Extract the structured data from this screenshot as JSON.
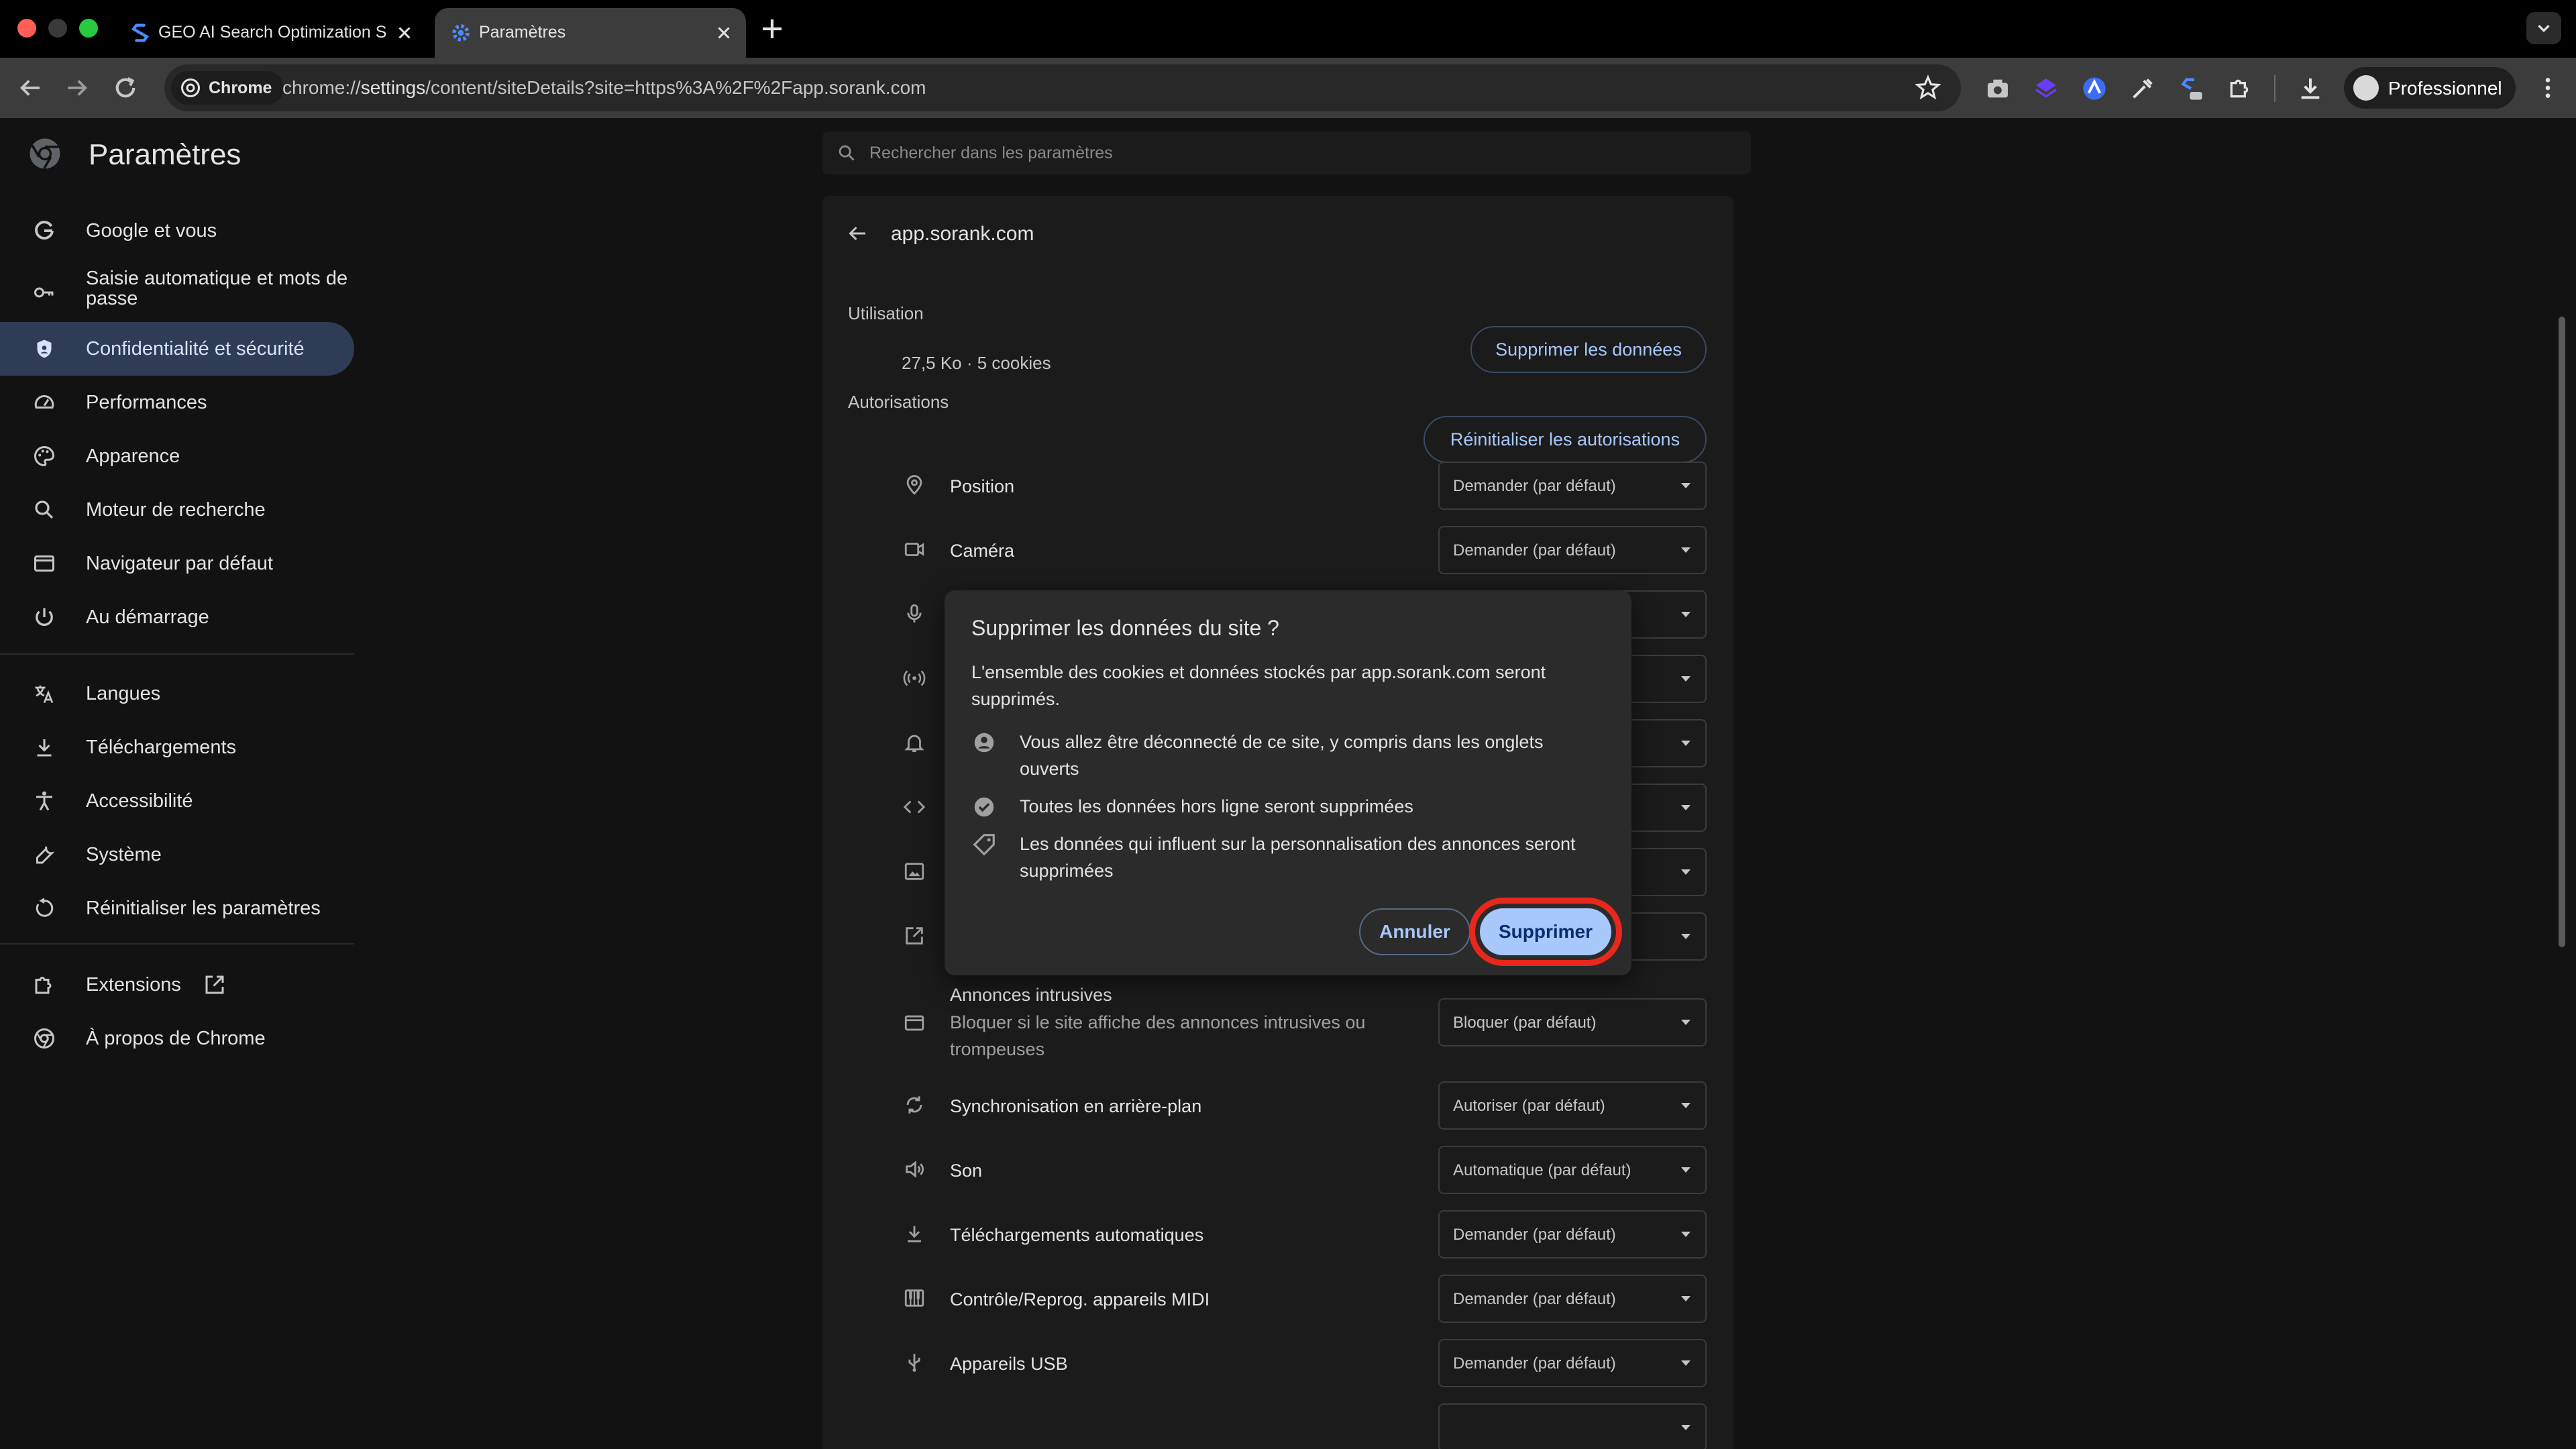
{
  "window": {
    "tabs": [
      {
        "label": "GEO AI Search Optimization S",
        "favicon": "sorank-icon",
        "active": false
      },
      {
        "label": "Paramètres",
        "favicon": "gear-icon",
        "active": true
      }
    ]
  },
  "toolbar": {
    "chip_label": "Chrome",
    "url_prefix": "chrome://",
    "url_host": "settings",
    "url_rest": "/content/siteDetails?site=https%3A%2F%2Fapp.sorank.com",
    "profile_label": "Professionnel"
  },
  "settings": {
    "title": "Paramètres",
    "search_placeholder": "Rechercher dans les paramètres",
    "nav": [
      {
        "label": "Google et vous",
        "icon": "google-icon"
      },
      {
        "label": "Saisie automatique et mots de passe",
        "icon": "key-icon"
      },
      {
        "label": "Confidentialité et sécurité",
        "icon": "shield-icon",
        "selected": true
      },
      {
        "label": "Performances",
        "icon": "speedometer-icon"
      },
      {
        "label": "Apparence",
        "icon": "palette-icon"
      },
      {
        "label": "Moteur de recherche",
        "icon": "search-icon"
      },
      {
        "label": "Navigateur par défaut",
        "icon": "browser-icon"
      },
      {
        "label": "Au démarrage",
        "icon": "power-icon"
      },
      {
        "label": "Langues",
        "icon": "translate-icon"
      },
      {
        "label": "Téléchargements",
        "icon": "download-icon"
      },
      {
        "label": "Accessibilité",
        "icon": "accessibility-icon"
      },
      {
        "label": "Système",
        "icon": "wrench-icon"
      },
      {
        "label": "Réinitialiser les paramètres",
        "icon": "reset-icon"
      },
      {
        "label": "Extensions",
        "icon": "puzzle-icon"
      },
      {
        "label": "À propos de Chrome",
        "icon": "chrome-icon"
      }
    ]
  },
  "site": {
    "name": "app.sorank.com",
    "usage_heading": "Utilisation",
    "usage_value": "27,5 Ko · 5 cookies",
    "delete_data_button": "Supprimer les données",
    "permissions_heading": "Autorisations",
    "reset_permissions_button": "Réinitialiser les autorisations",
    "permissions": [
      {
        "label": "Position",
        "value": "Demander (par défaut)",
        "icon": "location-icon"
      },
      {
        "label": "Caméra",
        "value": "Demander (par défaut)",
        "icon": "camera-icon"
      },
      {
        "label": "",
        "value": "",
        "icon": "microphone-icon"
      },
      {
        "label": "",
        "value": "",
        "icon": "sensors-icon"
      },
      {
        "label": "",
        "value": "",
        "icon": "bell-icon"
      },
      {
        "label": "",
        "value": "",
        "icon": "code-icon"
      },
      {
        "label": "",
        "value": "",
        "icon": "image-icon"
      },
      {
        "label": "",
        "value": "",
        "icon": "popup-icon"
      },
      {
        "label": "Annonces intrusives",
        "desc": "Bloquer si le site affiche des annonces intrusives ou trompeuses",
        "value": "Bloquer (par défaut)",
        "icon": "ads-icon"
      },
      {
        "label": "Synchronisation en arrière-plan",
        "value": "Autoriser (par défaut)",
        "icon": "sync-icon"
      },
      {
        "label": "Son",
        "value": "Automatique (par défaut)",
        "icon": "speaker-icon"
      },
      {
        "label": "Téléchargements automatiques",
        "value": "Demander (par défaut)",
        "icon": "download-icon"
      },
      {
        "label": "Contrôle/Reprog. appareils MIDI",
        "value": "Demander (par défaut)",
        "icon": "piano-icon"
      },
      {
        "label": "Appareils USB",
        "value": "Demander (par défaut)",
        "icon": "usb-icon"
      }
    ]
  },
  "dialog": {
    "title": "Supprimer les données du site ?",
    "body": "L'ensemble des cookies et données stockés par app.sorank.com seront supprimés.",
    "items": [
      {
        "text": "Vous allez être déconnecté de ce site, y compris dans les onglets ouverts",
        "icon": "account-icon"
      },
      {
        "text": "Toutes les données hors ligne seront supprimées",
        "icon": "offline-check-icon"
      },
      {
        "text": "Les données qui influent sur la personnalisation des annonces seront supprimées",
        "icon": "tag-icon"
      }
    ],
    "cancel_label": "Annuler",
    "confirm_label": "Supprimer"
  },
  "colors": {
    "accent": "#a8c7fa",
    "selected_nav": "#2e3c55",
    "highlight_ring": "#e8281d"
  }
}
